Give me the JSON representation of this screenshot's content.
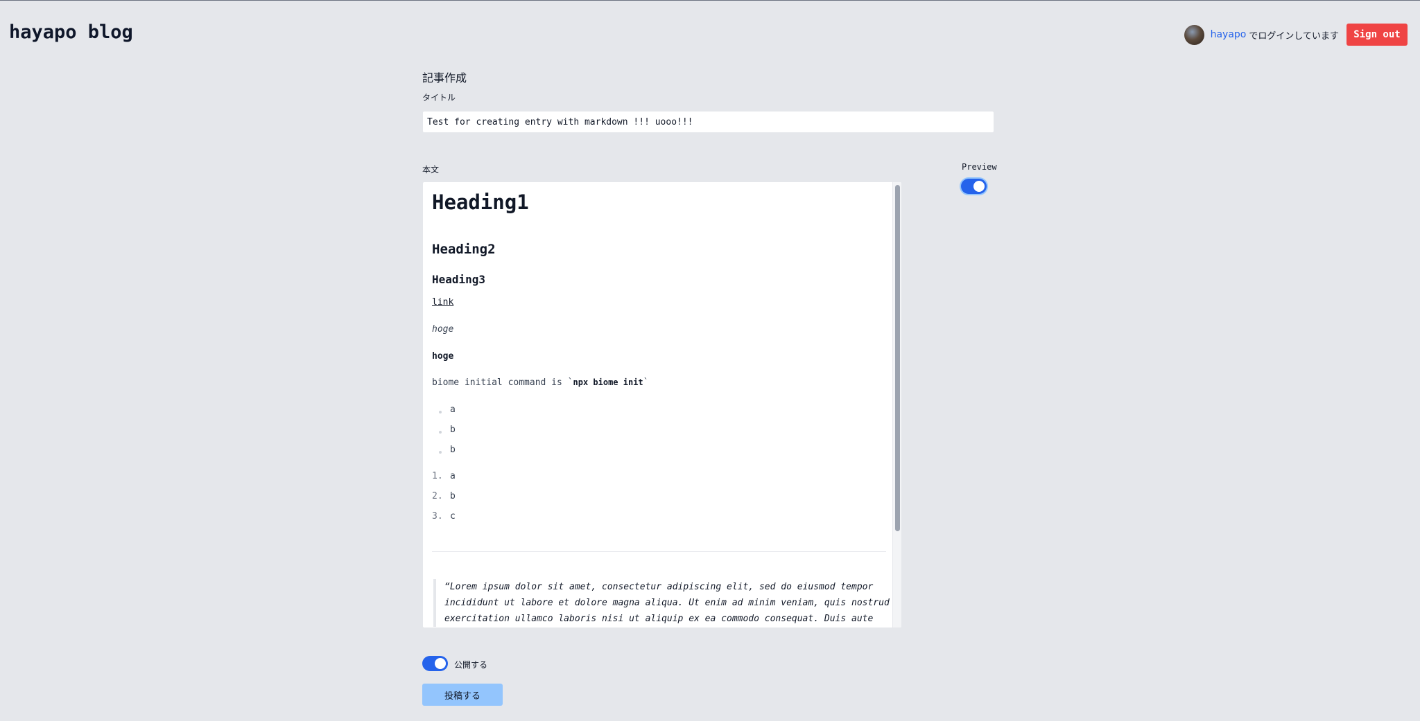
{
  "header": {
    "site_title": "hayapo blog",
    "user_name": "hayapo",
    "login_status": "でログインしています",
    "signout_label": "Sign out"
  },
  "form": {
    "heading": "記事作成",
    "title_label": "タイトル",
    "title_value": "Test for creating entry with markdown !!! uooo!!!",
    "body_label": "本文",
    "preview_label": "Preview",
    "preview_enabled": true,
    "publish_label": "公開する",
    "publish_enabled": true,
    "submit_label": "投稿する"
  },
  "preview": {
    "h1": "Heading1",
    "h2": "Heading2",
    "h3": "Heading3",
    "link": "link",
    "emphasis": "hoge",
    "strong": "hoge",
    "code_text_before": "biome initial command is `",
    "code": "npx biome init",
    "code_text_after": "`",
    "ul": [
      "a",
      "b",
      "b"
    ],
    "ol": [
      "a",
      "b",
      "c"
    ],
    "ol_numbers": [
      "1.",
      "2.",
      "3."
    ],
    "blockquote": "“Lorem ipsum dolor sit amet, consectetur adipiscing elit, sed do eiusmod tempor incididunt ut labore et dolore magna aliqua. Ut enim ad minim veniam, quis nostrud exercitation ullamco laboris nisi ut aliquip ex ea commodo consequat. Duis aute"
  },
  "colors": {
    "background": "#e5e7eb",
    "accent": "#2563eb",
    "signout": "#ef4444",
    "submit": "#93c5fd"
  }
}
